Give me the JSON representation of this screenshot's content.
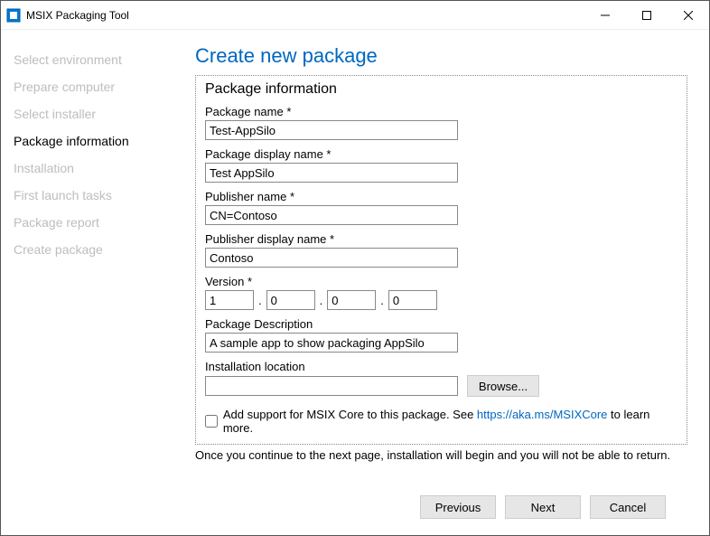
{
  "window": {
    "title": "MSIX Packaging Tool"
  },
  "sidebar": {
    "steps": [
      {
        "label": "Select environment"
      },
      {
        "label": "Prepare computer"
      },
      {
        "label": "Select installer"
      },
      {
        "label": "Package information"
      },
      {
        "label": "Installation"
      },
      {
        "label": "First launch tasks"
      },
      {
        "label": "Package report"
      },
      {
        "label": "Create package"
      }
    ],
    "active_index": 3
  },
  "page": {
    "title": "Create new package",
    "section_title": "Package information",
    "fields": {
      "package_name": {
        "label": "Package name *",
        "value": "Test-AppSilo"
      },
      "display_name": {
        "label": "Package display name *",
        "value": "Test AppSilo"
      },
      "publisher_name": {
        "label": "Publisher name *",
        "value": "CN=Contoso"
      },
      "publisher_display": {
        "label": "Publisher display name *",
        "value": "Contoso"
      },
      "version": {
        "label": "Version *",
        "v1": "1",
        "v2": "0",
        "v3": "0",
        "v4": "0"
      },
      "description": {
        "label": "Package Description",
        "value": "A sample app to show packaging AppSilo"
      },
      "install_location": {
        "label": "Installation location",
        "value": "",
        "browse": "Browse..."
      }
    },
    "msix_core": {
      "prefix": "Add support for MSIX Core to this package. See ",
      "link": "https://aka.ms/MSIXCore",
      "suffix": " to learn more."
    },
    "note": "Once you continue to the next page, installation will begin and you will not be able to return."
  },
  "footer": {
    "previous": "Previous",
    "next": "Next",
    "cancel": "Cancel"
  }
}
